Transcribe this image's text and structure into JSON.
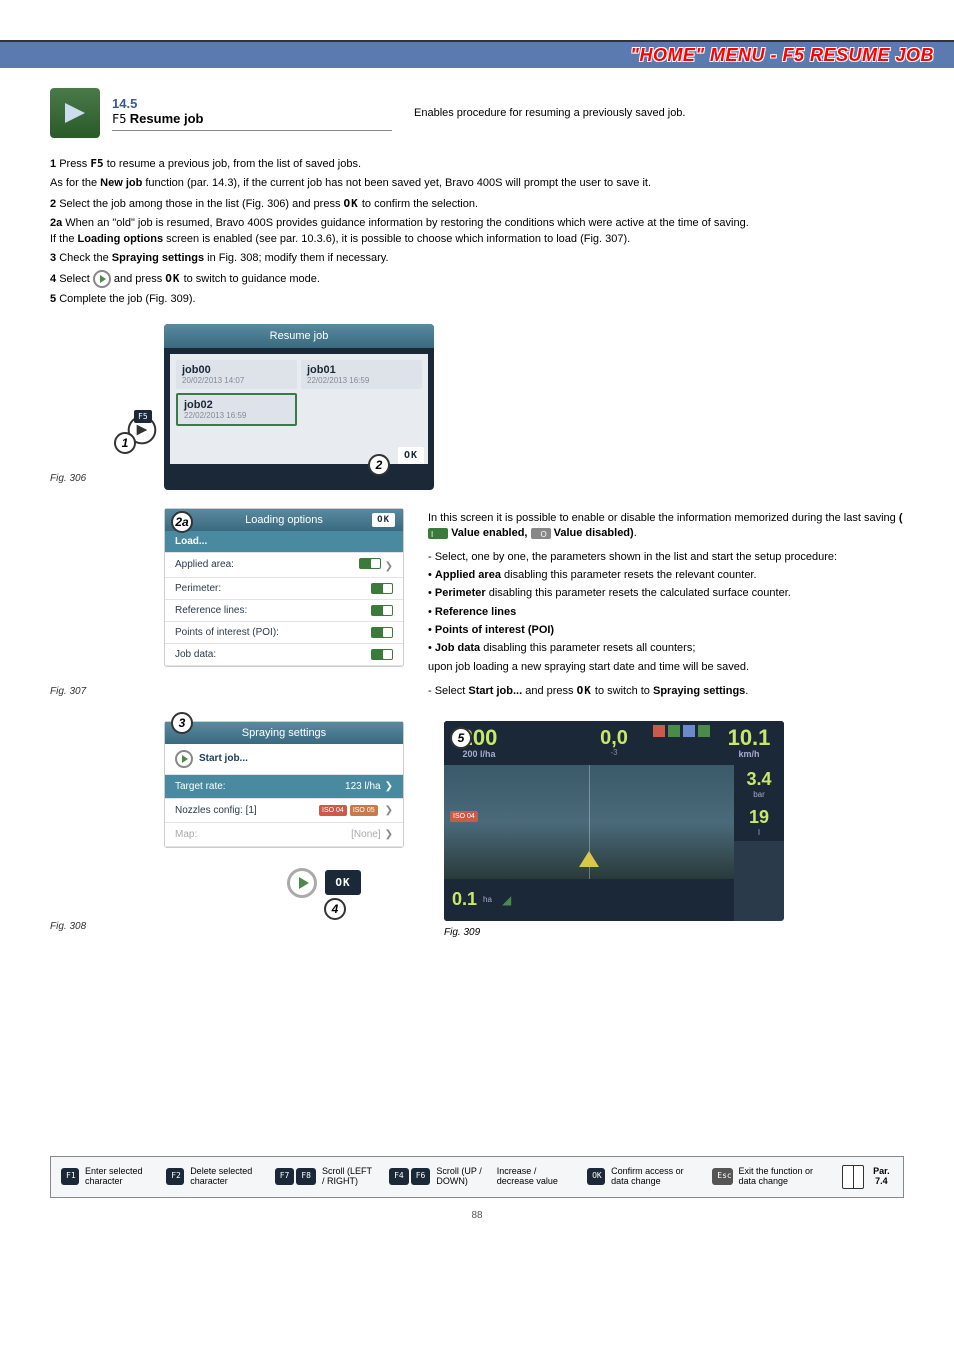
{
  "header": {
    "blue_bar_title": "\"HOME\" MENU - F5 RESUME JOB",
    "section_number": "14.5",
    "f5_label": "F5",
    "section_title": "Resume job",
    "description": "Enables procedure for resuming a previously saved job."
  },
  "steps": {
    "s1a": "Press",
    "s1_key": "F5",
    "s1b": "to resume a previous job, from the list of saved jobs.",
    "s1_note_a": "As for the",
    "s1_note_bold": "New job",
    "s1_note_b": "function (par. 14.3), if the current job has not been saved yet, Bravo 400S will prompt the user to save it.",
    "s2a": "Select the job among those in the list (Fig. 306) and press",
    "s2b": "to confirm the selection.",
    "s2a_a": "When an \"old\" job is resumed, Bravo 400S provides guidance information by restoring the conditions which were active at the time of saving.",
    "s2a_b": "If the",
    "s2a_bold": "Loading options",
    "s2a_c": "screen is enabled (see par. 10.3.6), it is possible to choose which information to load (Fig. 307).",
    "s3a": "Check the",
    "s3_bold": "Spraying settings",
    "s3b": "in Fig. 308; modify them if necessary.",
    "s4a": "Select",
    "s4b": "and press",
    "s4c": "to switch to guidance mode.",
    "s5": "Complete the job (Fig. 309).",
    "ok": "OK"
  },
  "fig306": {
    "caption": "Fig. 306",
    "title": "Resume job",
    "ok": "OK",
    "jobs": [
      {
        "name": "job00",
        "date": "20/02/2013 14:07"
      },
      {
        "name": "job01",
        "date": "22/02/2013 16:59"
      },
      {
        "name": "job02",
        "date": "22/02/2013 16:59"
      }
    ]
  },
  "fig307": {
    "caption": "Fig. 307",
    "title": "Loading options",
    "ok": "OK",
    "rows": {
      "load": "Load...",
      "applied": "Applied area:",
      "perimeter": "Perimeter:",
      "reflines": "Reference lines:",
      "poi": "Points of interest (POI):",
      "jobdata": "Job data:"
    },
    "info": {
      "intro": "In this screen it is possible to enable or disable the information memorized during the last saving",
      "enabled_label": "Value enabled,",
      "disabled_label": "Value disabled)",
      "select_line": "- Select, one by one, the parameters shown in the list and start the setup procedure:",
      "b1": "Applied area",
      "b1t": "disabling this parameter resets the relevant counter.",
      "b2": "Perimeter",
      "b2t": "disabling this parameter resets the calculated surface counter.",
      "b3": "Reference lines",
      "b4": "Points of interest (POI)",
      "b5": "Job data",
      "b5t": "disabling this parameter resets all counters;",
      "b5t2": "upon job loading a new spraying start date and time will be saved.",
      "final_a": "- Select",
      "final_bold": "Start job...",
      "final_b": "and press",
      "final_c": "to switch to",
      "final_bold2": "Spraying settings",
      "final_d": "."
    }
  },
  "fig308": {
    "caption": "Fig. 308",
    "title": "Spraying settings",
    "start": "Start job...",
    "target_label": "Target rate:",
    "target_value": "123  l/ha",
    "nozzles_label": "Nozzles config:  [1]",
    "nozzle_badge1": "ISO 04",
    "nozzle_badge2": "ISO 05",
    "map_label": "Map:",
    "map_value": "[None]",
    "ok": "OK"
  },
  "fig309": {
    "caption": "Fig. 309",
    "top_left_val": "200",
    "top_left_unit": "200 l/ha",
    "top_center": "0,0",
    "top_center_sub": "-3",
    "top_right_val": "10.1",
    "top_right_unit": "km/h",
    "side_v1": "3.4",
    "side_u1": "bar",
    "side_v2": "19",
    "side_u2": "l",
    "left_badge": "ISO 04",
    "bottom_val": "0.1",
    "bottom_unit": "ha"
  },
  "footer": {
    "f1": "F1",
    "f1_text": "Enter selected character",
    "f2": "F2",
    "f2_text": "Delete selected character",
    "f7": "F7",
    "f8": "F8",
    "scroll_lr": "Scroll (LEFT / RIGHT)",
    "f4": "F4",
    "f6": "F6",
    "scroll_ud": "Scroll (UP / DOWN)",
    "inc_dec": "Increase / decrease value",
    "ok": "OK",
    "ok_text": "Confirm access or data change",
    "esc": "Esc",
    "esc_text": "Exit the function or data change",
    "par": "Par. 7.4"
  },
  "callouts": {
    "c1": "1",
    "c2": "2",
    "c2a": "2a",
    "c3": "3",
    "c4": "4",
    "c5": "5"
  },
  "page_number": "88"
}
